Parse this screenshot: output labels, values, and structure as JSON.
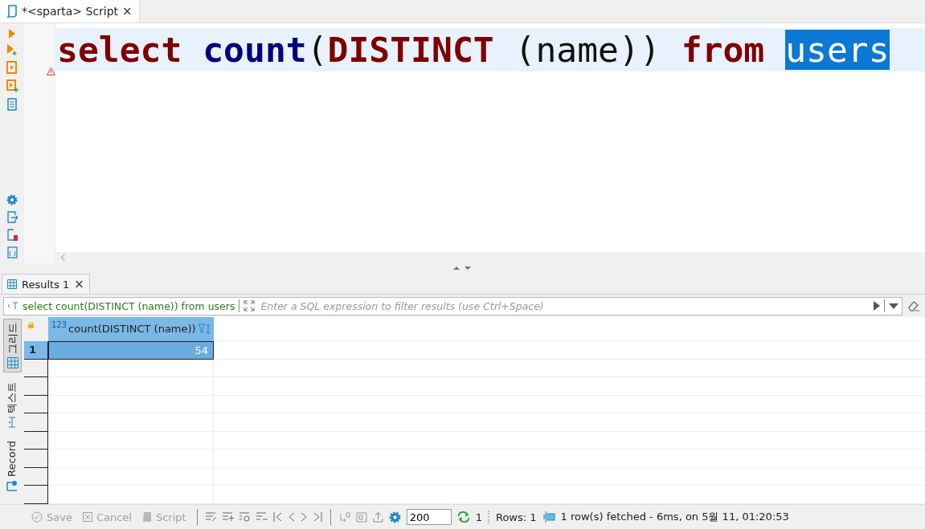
{
  "editor_tab": {
    "title": "*<sparta> Script",
    "close": "×"
  },
  "code_line": [
    {
      "kind": "keyword",
      "text": "select "
    },
    {
      "kind": "function",
      "text": "count"
    },
    {
      "kind": "plain",
      "text": "("
    },
    {
      "kind": "keyword",
      "text": "DISTINCT"
    },
    {
      "kind": "plain",
      "text": " (name)) "
    },
    {
      "kind": "keyword",
      "text": "from "
    },
    {
      "kind": "selected",
      "text": "users"
    }
  ],
  "results_tab": {
    "title": "Results 1",
    "close": "×",
    "selected": true
  },
  "filter_bar": {
    "query": "select count(DISTINCT (name)) from users",
    "placeholder": "Enter a SQL expression to filter results (use Ctrl+Space)"
  },
  "view_tabs": [
    {
      "label": "그리드",
      "selected": true
    },
    {
      "label": "텍스트",
      "selected": false
    },
    {
      "label": "Record",
      "selected": false
    }
  ],
  "grid": {
    "columns": [
      {
        "type_badge": "123",
        "name": "count(DISTINCT (name))"
      }
    ],
    "rows": [
      {
        "number": "1",
        "cells": [
          "54"
        ],
        "selected": true
      }
    ]
  },
  "toolbar": {
    "buttons": [
      {
        "label": "Save",
        "disabled": true
      },
      {
        "label": "Cancel",
        "disabled": true
      },
      {
        "label": "Script",
        "disabled": true
      }
    ],
    "fetch_size": "200",
    "refresh_count": "1",
    "rows": "Rows: 1",
    "status": "1 row(s) fetched - 6ms, on 5월 11, 01:20:53"
  }
}
